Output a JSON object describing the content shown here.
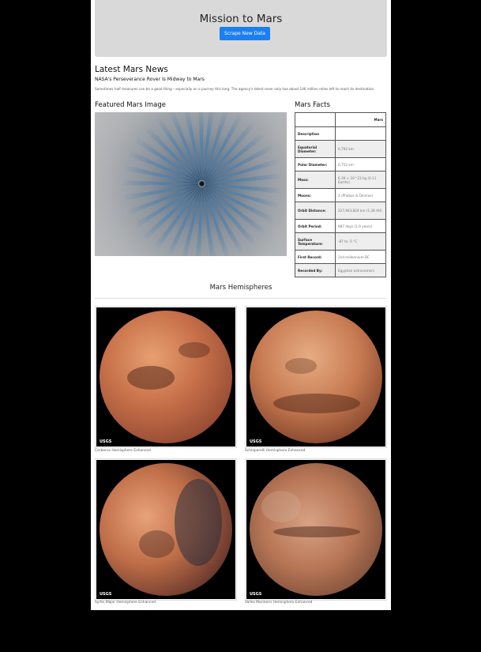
{
  "header": {
    "title": "Mission to Mars",
    "scrape_button": "Scrape New Data"
  },
  "news": {
    "heading": "Latest Mars News",
    "title": "NASA's Perseverance Rover Is Midway to Mars",
    "paragraph": "Sometimes half measures can be a good thing – especially on a journey this long. The agency's latest rover only has about 146 million miles left to reach its destination."
  },
  "featured": {
    "heading": "Featured Mars Image"
  },
  "facts": {
    "heading": "Mars Facts",
    "column_header": "Mars",
    "rows": [
      {
        "label": "Description",
        "value": ""
      },
      {
        "label": "Equatorial Diameter:",
        "value": "6,792 km"
      },
      {
        "label": "Polar Diameter:",
        "value": "6,752 km"
      },
      {
        "label": "Mass:",
        "value": "6.39 × 10^23 kg (0.11 Earths)"
      },
      {
        "label": "Moons:",
        "value": "2 (Phobos & Deimos)"
      },
      {
        "label": "Orbit Distance:",
        "value": "227,943,824 km (1.38 AU)"
      },
      {
        "label": "Orbit Period:",
        "value": "687 days (1.9 years)"
      },
      {
        "label": "Surface Temperature:",
        "value": "-87 to -5 °C"
      },
      {
        "label": "First Record:",
        "value": "2nd millennium BC"
      },
      {
        "label": "Recorded By:",
        "value": "Egyptian astronomers"
      }
    ]
  },
  "hemispheres": {
    "heading": "Mars Hemispheres",
    "items": [
      {
        "caption": "Cerberus Hemisphere Enhanced",
        "logo": "USGS"
      },
      {
        "caption": "Schiaparelli Hemisphere Enhanced",
        "logo": "USGS"
      },
      {
        "caption": "Syrtis Major Hemisphere Enhanced",
        "logo": "USGS"
      },
      {
        "caption": "Valles Marineris Hemisphere Enhanced",
        "logo": "USGS"
      }
    ]
  },
  "colors": {
    "page_background": "#000000",
    "jumbotron": "#d9d9d9",
    "button": "#1a7ff2"
  }
}
